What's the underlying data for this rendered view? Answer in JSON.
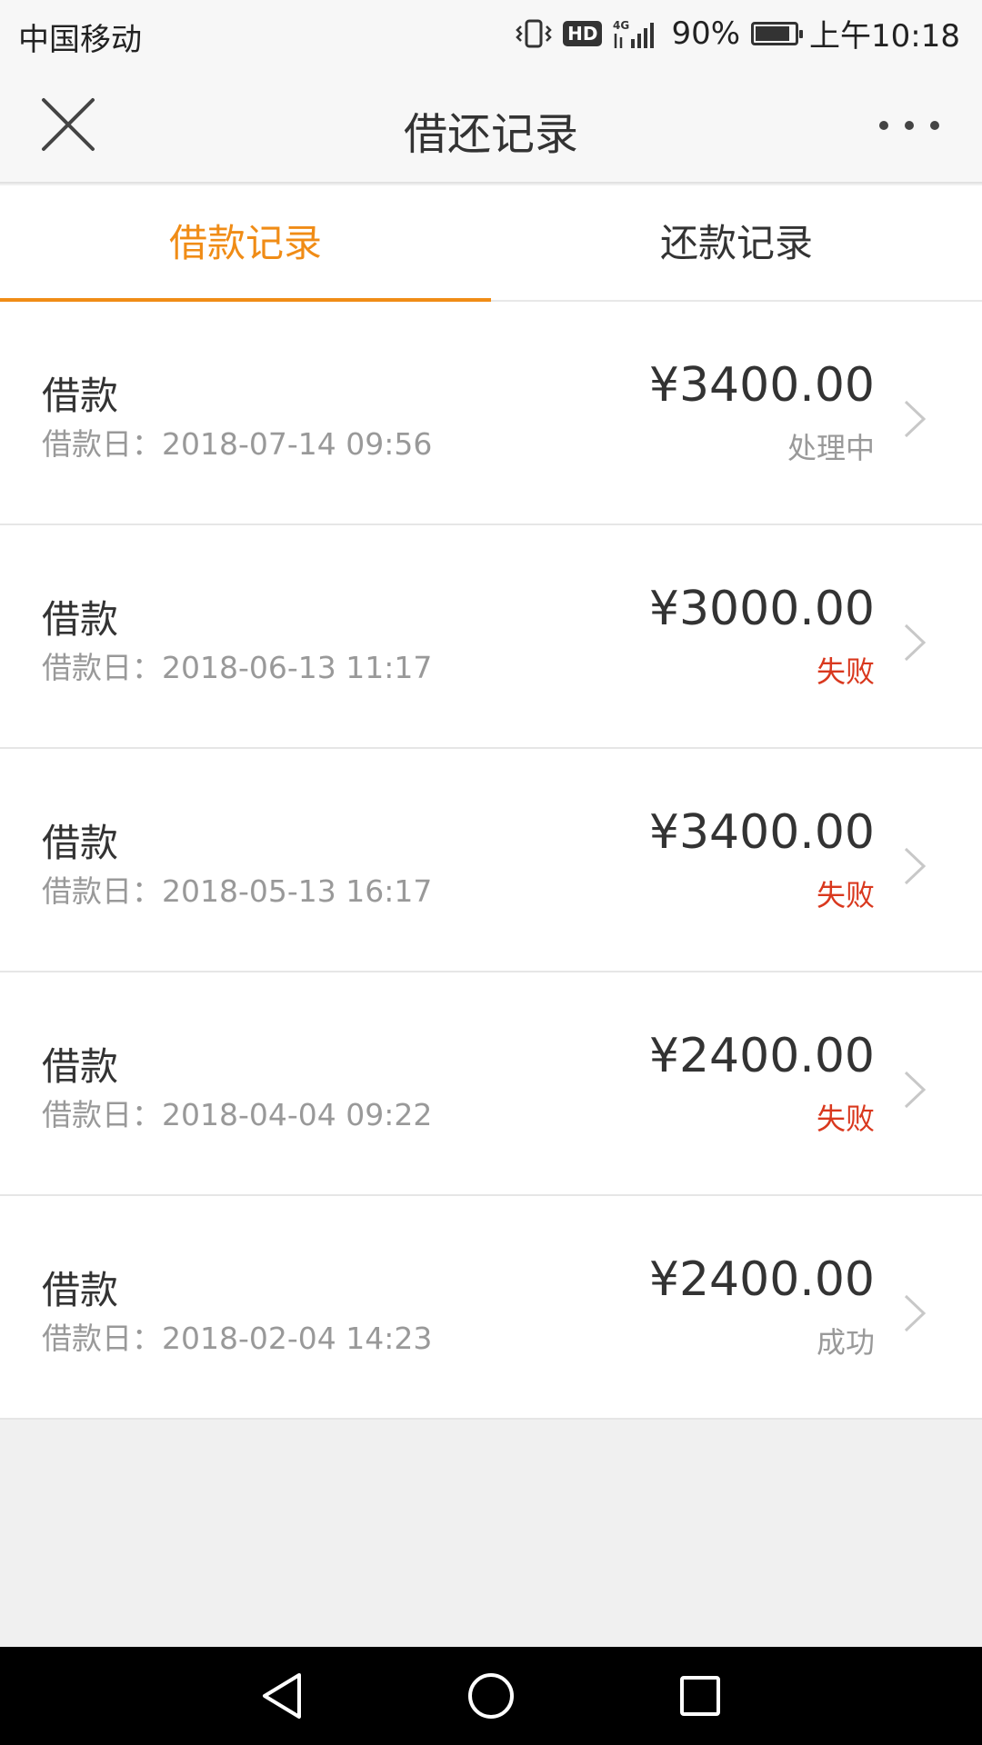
{
  "status_bar": {
    "carrier": "中国移动",
    "network": "4G",
    "hd": "HD",
    "battery_percent": "90%",
    "battery_level": 0.9,
    "time": "上午10:18"
  },
  "header": {
    "title": "借还记录"
  },
  "tabs": [
    {
      "label": "借款记录",
      "active": true
    },
    {
      "label": "还款记录",
      "active": false
    }
  ],
  "colors": {
    "accent": "#f08c16",
    "fail": "#d9381e",
    "muted": "#999999"
  },
  "records": [
    {
      "title": "借款",
      "date": "借款日：2018-07-14 09:56",
      "amount": "¥3400.00",
      "status": "处理中",
      "status_type": "pending"
    },
    {
      "title": "借款",
      "date": "借款日：2018-06-13 11:17",
      "amount": "¥3000.00",
      "status": "失败",
      "status_type": "fail"
    },
    {
      "title": "借款",
      "date": "借款日：2018-05-13 16:17",
      "amount": "¥3400.00",
      "status": "失败",
      "status_type": "fail"
    },
    {
      "title": "借款",
      "date": "借款日：2018-04-04 09:22",
      "amount": "¥2400.00",
      "status": "失败",
      "status_type": "fail"
    },
    {
      "title": "借款",
      "date": "借款日：2018-02-04 14:23",
      "amount": "¥2400.00",
      "status": "成功",
      "status_type": "success"
    }
  ]
}
